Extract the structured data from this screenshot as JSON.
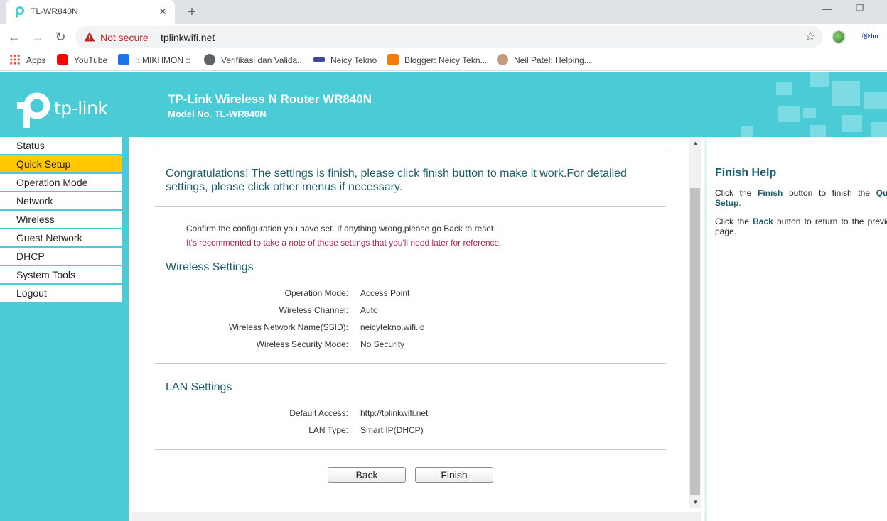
{
  "browser": {
    "tab_title": "TL-WR840N",
    "new_tab": "+",
    "close": "✕",
    "not_secure": "Not secure",
    "url": "tplinkwifi.net",
    "ext2_label": "Ⓝ·bn"
  },
  "bookmarks": [
    {
      "label": "Apps",
      "icon": "apps-grid-icon",
      "color": "#e8453c"
    },
    {
      "label": "YouTube",
      "icon": "youtube-icon",
      "color": "#ff0000"
    },
    {
      "label": ":: MIKHMON ::",
      "icon": "mikhmon-icon",
      "color": "#1a73e8"
    },
    {
      "label": "Verifikasi dan Valida...",
      "icon": "globe-icon",
      "color": "#5f6368"
    },
    {
      "label": "Neicy Tekno",
      "icon": "neicy-icon",
      "color": "#3b4a9a"
    },
    {
      "label": "Blogger: Neicy Tekn...",
      "icon": "blogger-icon",
      "color": "#f57d00"
    },
    {
      "label": "Neil Patel: Helping...",
      "icon": "neil-avatar-icon",
      "color": "#c49a7a"
    }
  ],
  "router": {
    "logo_text": "tp-link",
    "title": "TP-Link Wireless N Router WR840N",
    "model": "Model No. TL-WR840N",
    "brand_color": "#4acbd6",
    "active_color": "#ffc800"
  },
  "menu": [
    {
      "label": "Status",
      "active": false
    },
    {
      "label": "Quick Setup",
      "active": true
    },
    {
      "label": "Operation Mode",
      "active": false
    },
    {
      "label": "Network",
      "active": false
    },
    {
      "label": "Wireless",
      "active": false
    },
    {
      "label": "Guest Network",
      "active": false
    },
    {
      "label": "DHCP",
      "active": false
    },
    {
      "label": "System Tools",
      "active": false
    },
    {
      "label": "Logout",
      "active": false
    }
  ],
  "content": {
    "congrats": "Congratulations! The settings is finish, please click finish button to make it work.For detailed settings, please click other menus if necessary.",
    "confirm": "Confirm the configuration you have set. If anything wrong,please go Back to reset.",
    "recommend": "It's recommented to take a note of these settings that you'll need later for reference.",
    "wireless_title": "Wireless Settings",
    "wireless_rows": [
      {
        "label": "Operation Mode:",
        "value": "Access Point"
      },
      {
        "label": "Wireless Channel:",
        "value": "Auto"
      },
      {
        "label": "Wireless Network Name(SSID):",
        "value": "neicytekno.wifi.id"
      },
      {
        "label": "Wireless Security Mode:",
        "value": "No Security"
      }
    ],
    "lan_title": "LAN Settings",
    "lan_rows": [
      {
        "label": "Default Access:",
        "value": "http://tplinkwifi.net"
      },
      {
        "label": "LAN Type:",
        "value": "Smart IP(DHCP)"
      }
    ],
    "back_label": "Back",
    "finish_label": "Finish"
  },
  "help": {
    "title": "Finish Help",
    "p1_pre": "Click the ",
    "p1_bold": "Finish",
    "p1_mid": " button to finish the ",
    "p1_bold2": "Quick Setup",
    "p1_post": ".",
    "p2_pre": "Click the ",
    "p2_bold": "Back",
    "p2_post": " button to return to the previous page."
  }
}
